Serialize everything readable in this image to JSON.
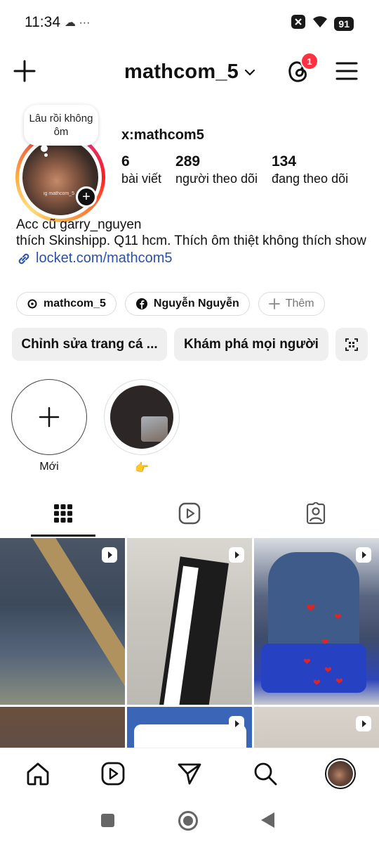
{
  "status_bar": {
    "time": "11:34",
    "extra_icons": "☁ ···",
    "battery": "91"
  },
  "header": {
    "username": "mathcom_5",
    "notification_count": "1"
  },
  "profile": {
    "note": "Lâu rồi không ôm",
    "avatar_watermark": "ig mathcom_5",
    "display_name": "x:mathcom5",
    "stats": [
      {
        "value": "6",
        "label": "bài viết"
      },
      {
        "value": "289",
        "label": "người theo dõi"
      },
      {
        "value": "134",
        "label": "đang theo dõi"
      }
    ],
    "bio_line1": "Acc cũ garry_nguyen",
    "bio_line2": "thích Skinshipp. Q11 hcm. Thích ôm thiệt không thích show",
    "link": "locket.com/mathcom5"
  },
  "chips": {
    "threads": "mathcom_5",
    "facebook": "Nguyễn Nguyễn",
    "more": "Thêm"
  },
  "actions": {
    "edit_profile": "Chỉnh sửa trang cá ...",
    "discover": "Khám phá mọi người"
  },
  "highlights": [
    {
      "label": "Mới"
    },
    {
      "label": "👉"
    }
  ],
  "colors": {
    "link": "#2b50a8",
    "badge": "#ff3040",
    "button_bg": "#efefef"
  }
}
